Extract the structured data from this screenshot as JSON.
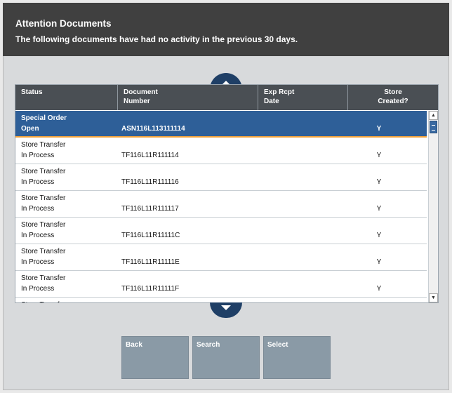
{
  "header": {
    "title": "Attention Documents",
    "subtitle": "The following documents have had no activity in the previous 30 days."
  },
  "table": {
    "columns": [
      "Status",
      "Document\nNumber",
      "Exp Rcpt\nDate",
      "Store\nCreated?"
    ],
    "rows": [
      {
        "status_line1": "Special Order",
        "status_line2": "Open",
        "document_number": "ASN116L113111114",
        "exp_rcpt_date": "",
        "store_created": "Y",
        "selected": true
      },
      {
        "status_line1": "Store Transfer",
        "status_line2": "In Process",
        "document_number": "TF116L11R111114",
        "exp_rcpt_date": "",
        "store_created": "Y"
      },
      {
        "status_line1": "Store Transfer",
        "status_line2": "In Process",
        "document_number": "TF116L11R111116",
        "exp_rcpt_date": "",
        "store_created": "Y"
      },
      {
        "status_line1": "Store Transfer",
        "status_line2": "In Process",
        "document_number": "TF116L11R111117",
        "exp_rcpt_date": "",
        "store_created": "Y"
      },
      {
        "status_line1": "Store Transfer",
        "status_line2": "In Process",
        "document_number": "TF116L11R11111C",
        "exp_rcpt_date": "",
        "store_created": "Y"
      },
      {
        "status_line1": "Store Transfer",
        "status_line2": "In Process",
        "document_number": "TF116L11R11111E",
        "exp_rcpt_date": "",
        "store_created": "Y"
      },
      {
        "status_line1": "Store Transfer",
        "status_line2": "In Process",
        "document_number": "TF116L11R11111F",
        "exp_rcpt_date": "",
        "store_created": "Y"
      },
      {
        "status_line1": "Store Transfer",
        "status_line2": "",
        "document_number": "",
        "exp_rcpt_date": "",
        "store_created": ""
      }
    ]
  },
  "buttons": {
    "back": "Back",
    "search": "Search",
    "select": "Select"
  },
  "icons": {
    "scroll_up": "chevron-up-icon",
    "scroll_down": "chevron-down-icon"
  },
  "colors": {
    "header_bg": "#404040",
    "selected_row": "#2e5f98",
    "selected_border": "#f2a23a",
    "scroll_button": "#1f3f66",
    "action_button": "#8a9aa6"
  }
}
